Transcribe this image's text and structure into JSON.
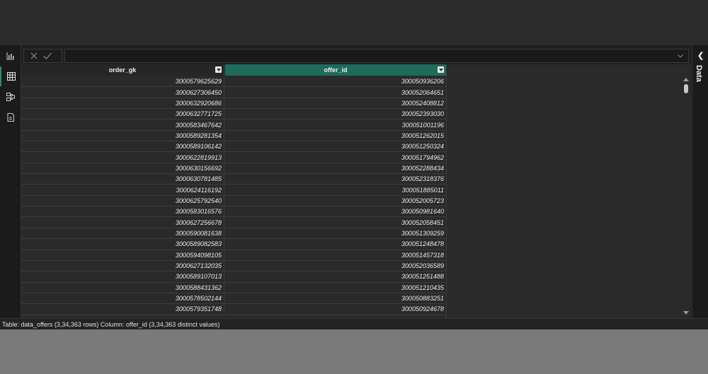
{
  "formula_bar": {
    "value": ""
  },
  "rail": {
    "items": [
      "report-view",
      "table-view",
      "model-view",
      "dax-query-view"
    ],
    "active": "table-view"
  },
  "table": {
    "columns": [
      {
        "name": "order_gk"
      },
      {
        "name": "offer_id"
      }
    ],
    "selected_column": "offer_id",
    "rows": [
      [
        "3000579625629",
        "300050936206"
      ],
      [
        "3000627306450",
        "300052064651"
      ],
      [
        "3000632920686",
        "300052408812"
      ],
      [
        "3000632771725",
        "300052393030"
      ],
      [
        "3000583467642",
        "300051001196"
      ],
      [
        "3000589281354",
        "300051262015"
      ],
      [
        "3000589106142",
        "300051250324"
      ],
      [
        "3000622819913",
        "300051794962"
      ],
      [
        "3000630156692",
        "300052288434"
      ],
      [
        "3000630781485",
        "300052318376"
      ],
      [
        "3000624116192",
        "300051885011"
      ],
      [
        "3000625792540",
        "300052005723"
      ],
      [
        "3000583016576",
        "300050981640"
      ],
      [
        "3000627256678",
        "300052058451"
      ],
      [
        "3000590081638",
        "300051309259"
      ],
      [
        "3000589082583",
        "300051248478"
      ],
      [
        "3000594098105",
        "300051457318"
      ],
      [
        "3000627132035",
        "300052036589"
      ],
      [
        "3000589107013",
        "300051251488"
      ],
      [
        "3000588431362",
        "300051210435"
      ],
      [
        "3000578502144",
        "300050883251"
      ],
      [
        "3000579351748",
        "300050924678"
      ]
    ]
  },
  "right_pane": {
    "label": "Data"
  },
  "status_bar": {
    "text": "Table: data_offers (3,34,363 rows) Column: offer_id (3,34,363 distinct values)"
  },
  "colors": {
    "accent": "#1c6b5b",
    "background": "#1f1f1f"
  }
}
